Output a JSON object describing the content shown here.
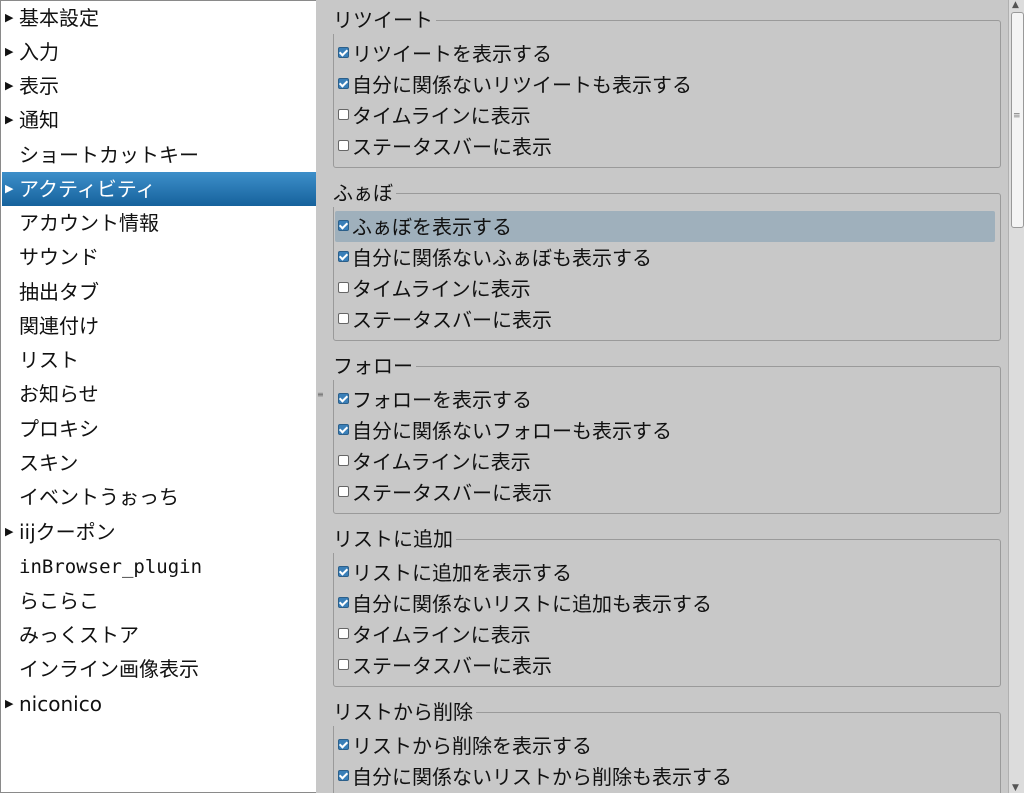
{
  "sidebar": {
    "items": [
      {
        "label": "基本設定",
        "expandable": true
      },
      {
        "label": "入力",
        "expandable": true
      },
      {
        "label": "表示",
        "expandable": true
      },
      {
        "label": "通知",
        "expandable": true
      },
      {
        "label": "ショートカットキー",
        "expandable": false
      },
      {
        "label": "アクティビティ",
        "expandable": true,
        "selected": true
      },
      {
        "label": "アカウント情報",
        "expandable": false
      },
      {
        "label": "サウンド",
        "expandable": false
      },
      {
        "label": "抽出タブ",
        "expandable": false
      },
      {
        "label": "関連付け",
        "expandable": false
      },
      {
        "label": "リスト",
        "expandable": false
      },
      {
        "label": "お知らせ",
        "expandable": false
      },
      {
        "label": "プロキシ",
        "expandable": false
      },
      {
        "label": "スキン",
        "expandable": false
      },
      {
        "label": "イベントうぉっち",
        "expandable": false
      },
      {
        "label": "iijクーポン",
        "expandable": true
      },
      {
        "label": "inBrowser_plugin",
        "expandable": false
      },
      {
        "label": "らこらこ",
        "expandable": false
      },
      {
        "label": "みっくストア",
        "expandable": false
      },
      {
        "label": "インライン画像表示",
        "expandable": false
      },
      {
        "label": "niconico",
        "expandable": true
      }
    ]
  },
  "groups": [
    {
      "title": "リツイート",
      "options": [
        {
          "label": "リツイートを表示する",
          "checked": true
        },
        {
          "label": "自分に関係ないリツイートも表示する",
          "checked": true
        },
        {
          "label": "タイムラインに表示",
          "checked": false
        },
        {
          "label": "ステータスバーに表示",
          "checked": false
        }
      ]
    },
    {
      "title": "ふぁぼ",
      "options": [
        {
          "label": "ふぁぼを表示する",
          "checked": true,
          "highlighted": true
        },
        {
          "label": "自分に関係ないふぁぼも表示する",
          "checked": true
        },
        {
          "label": "タイムラインに表示",
          "checked": false
        },
        {
          "label": "ステータスバーに表示",
          "checked": false
        }
      ]
    },
    {
      "title": "フォロー",
      "options": [
        {
          "label": "フォローを表示する",
          "checked": true
        },
        {
          "label": "自分に関係ないフォローも表示する",
          "checked": true
        },
        {
          "label": "タイムラインに表示",
          "checked": false
        },
        {
          "label": "ステータスバーに表示",
          "checked": false
        }
      ]
    },
    {
      "title": "リストに追加",
      "options": [
        {
          "label": "リストに追加を表示する",
          "checked": true
        },
        {
          "label": "自分に関係ないリストに追加も表示する",
          "checked": true
        },
        {
          "label": "タイムラインに表示",
          "checked": false
        },
        {
          "label": "ステータスバーに表示",
          "checked": false
        }
      ]
    },
    {
      "title": "リストから削除",
      "options": [
        {
          "label": "リストから削除を表示する",
          "checked": true
        },
        {
          "label": "自分に関係ないリストから削除も表示する",
          "checked": true
        }
      ]
    }
  ],
  "colors": {
    "selected_item": "#1f6ea8",
    "highlight_row": "#9fb0bc",
    "checkbox_on": "#3a7fb8"
  }
}
